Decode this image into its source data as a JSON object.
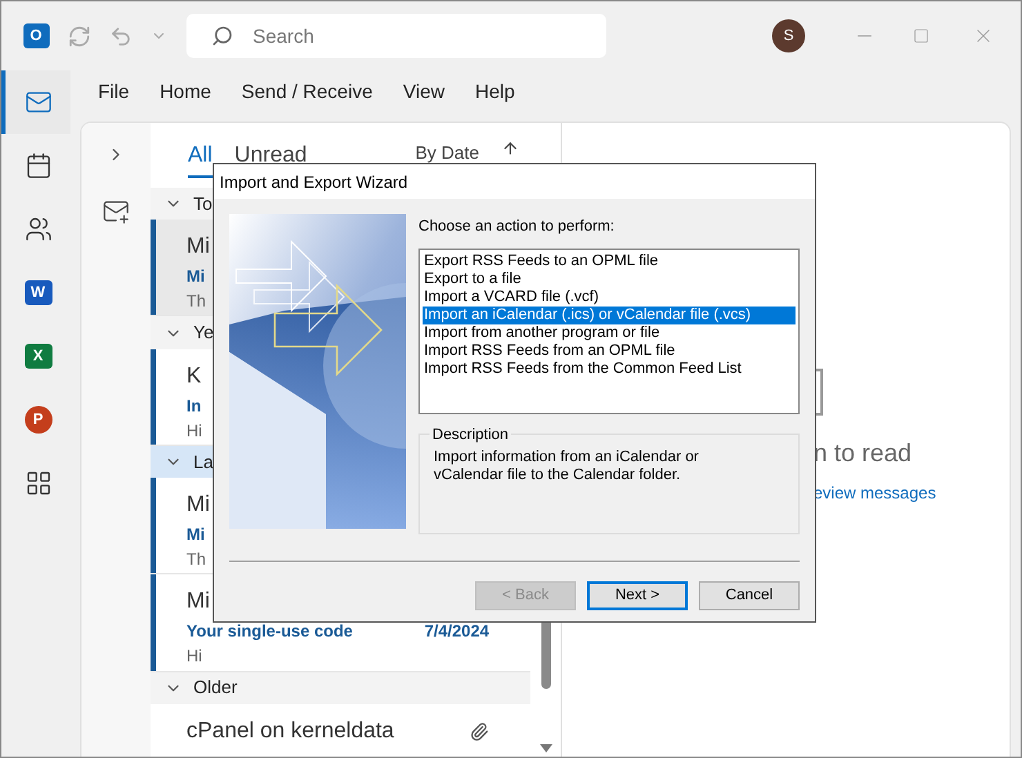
{
  "app_icon": {
    "letter": "O"
  },
  "search": {
    "placeholder": "Search"
  },
  "account": {
    "initial": "S"
  },
  "rail": [
    {
      "kind": "mail",
      "selected": true
    },
    {
      "kind": "calendar",
      "selected": false
    },
    {
      "kind": "people",
      "selected": false
    },
    {
      "kind": "word",
      "letter": "W",
      "selected": false
    },
    {
      "kind": "excel",
      "letter": "X",
      "selected": false
    },
    {
      "kind": "powerpoint",
      "letter": "P",
      "selected": false
    },
    {
      "kind": "apps",
      "selected": false
    }
  ],
  "menu": [
    "File",
    "Home",
    "Send / Receive",
    "View",
    "Help"
  ],
  "list_tabs": [
    {
      "label": "All",
      "selected": true
    },
    {
      "label": "Unread",
      "selected": false
    }
  ],
  "sort": {
    "label": "By Date"
  },
  "message_groups": [
    {
      "label": "To",
      "hovered": false,
      "messages": [
        {
          "sender": "Mi",
          "subject": "Mi",
          "preview": "Th",
          "selected": true,
          "unread": true
        }
      ]
    },
    {
      "label": "Ye",
      "hovered": false,
      "messages": [
        {
          "sender": "K",
          "subject": "In",
          "preview": "Hi",
          "selected": false,
          "unread": true
        }
      ]
    },
    {
      "label": "La",
      "hovered": true,
      "messages": [
        {
          "sender": "Mi",
          "subject": "Mi",
          "preview": "Th",
          "selected": false,
          "unread": true
        },
        {
          "sender": "Mi",
          "subject": "Your single-use code",
          "date": "7/4/2024",
          "preview": "Hi",
          "selected": false,
          "unread": true
        }
      ]
    },
    {
      "label": "Older",
      "hovered": false,
      "messages": [
        {
          "sender": "cPanel on kerneldata",
          "attachment": true,
          "selected": false,
          "unread": false
        }
      ]
    }
  ],
  "reading_pane": {
    "heading": "n to read",
    "link": "eview messages"
  },
  "dialog": {
    "title": "Import and Export Wizard",
    "prompt": "Choose an action to perform:",
    "actions": [
      {
        "label": "Export RSS Feeds to an OPML file",
        "selected": false
      },
      {
        "label": "Export to a file",
        "selected": false
      },
      {
        "label": "Import a VCARD file (.vcf)",
        "selected": false
      },
      {
        "label": "Import an iCalendar (.ics) or vCalendar file (.vcs)",
        "selected": true
      },
      {
        "label": "Import from another program or file",
        "selected": false
      },
      {
        "label": "Import RSS Feeds from an OPML file",
        "selected": false
      },
      {
        "label": "Import RSS Feeds from the Common Feed List",
        "selected": false
      }
    ],
    "description_title": "Description",
    "description": "Import information from an iCalendar or vCalendar file to the Calendar folder.",
    "buttons": [
      {
        "label": "< Back",
        "disabled": true,
        "default": false
      },
      {
        "label": "Next >",
        "disabled": false,
        "default": true
      },
      {
        "label": "Cancel",
        "disabled": false,
        "default": false
      }
    ]
  }
}
